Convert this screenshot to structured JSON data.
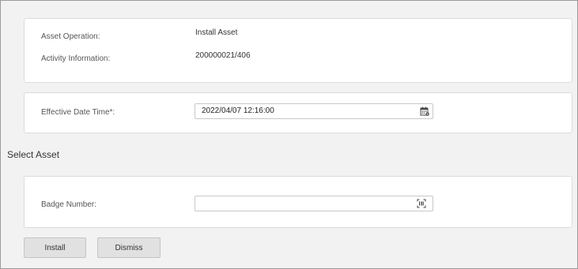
{
  "asset_info": {
    "asset_operation_label": "Asset Operation:",
    "asset_operation_value": "Install Asset",
    "activity_information_label": "Activity Information:",
    "activity_information_value": "200000021/406"
  },
  "effective_date": {
    "label": "Effective Date Time*:",
    "value": "2022/04/07 12:16:00",
    "icon": "calendar-icon"
  },
  "select_asset": {
    "title": "Select Asset",
    "badge_number_label": "Badge Number:",
    "badge_number_value": "",
    "icon": "barcode-scan-icon"
  },
  "actions": {
    "install_label": "Install",
    "dismiss_label": "Dismiss"
  }
}
